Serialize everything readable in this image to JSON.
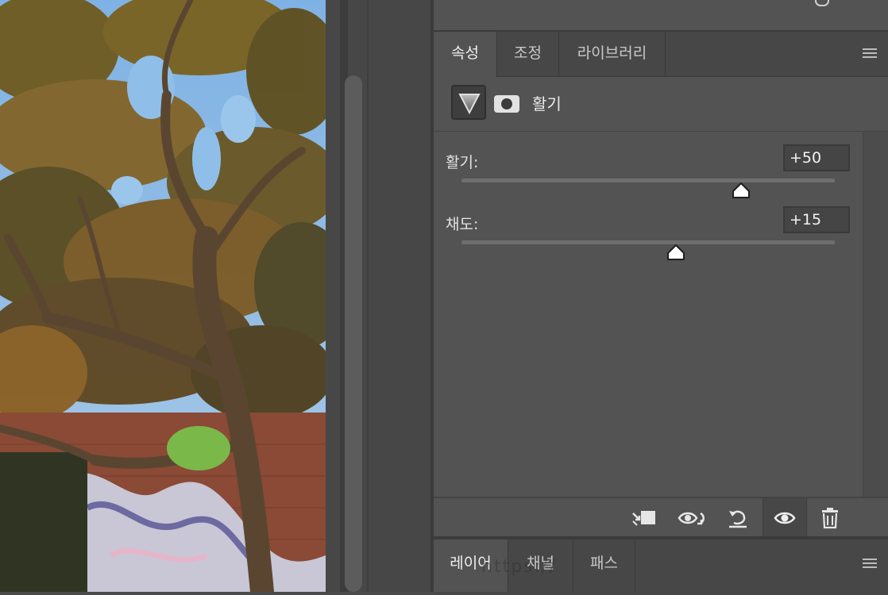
{
  "properties_panel": {
    "tabs": [
      {
        "label": "속성",
        "active": true
      },
      {
        "label": "조정",
        "active": false
      },
      {
        "label": "라이브러리",
        "active": false
      }
    ],
    "menu_icon": "panel-menu-icon",
    "header": {
      "adjustment_icon": "vibrance-triangle-icon",
      "mask_icon": "layer-mask-icon",
      "title": "활기"
    },
    "sliders": [
      {
        "label": "활기:",
        "value": "+50",
        "range": [
          -100,
          100
        ],
        "position": 50
      },
      {
        "label": "채도:",
        "value": "+15",
        "range": [
          -100,
          100
        ],
        "position": 15
      }
    ],
    "footer_icons": [
      "clip-to-layer-icon",
      "view-previous-state-icon",
      "reset-icon",
      "toggle-visibility-icon",
      "delete-icon"
    ]
  },
  "layers_panel": {
    "tabs": [
      {
        "label": "레이어",
        "active": true
      },
      {
        "label": "채널",
        "active": false
      },
      {
        "label": "패스",
        "active": false
      }
    ],
    "watermark": "https://"
  },
  "colors": {
    "panel_bg": "#535353",
    "tabbar_bg": "#474747",
    "text": "#e6e6e6"
  }
}
